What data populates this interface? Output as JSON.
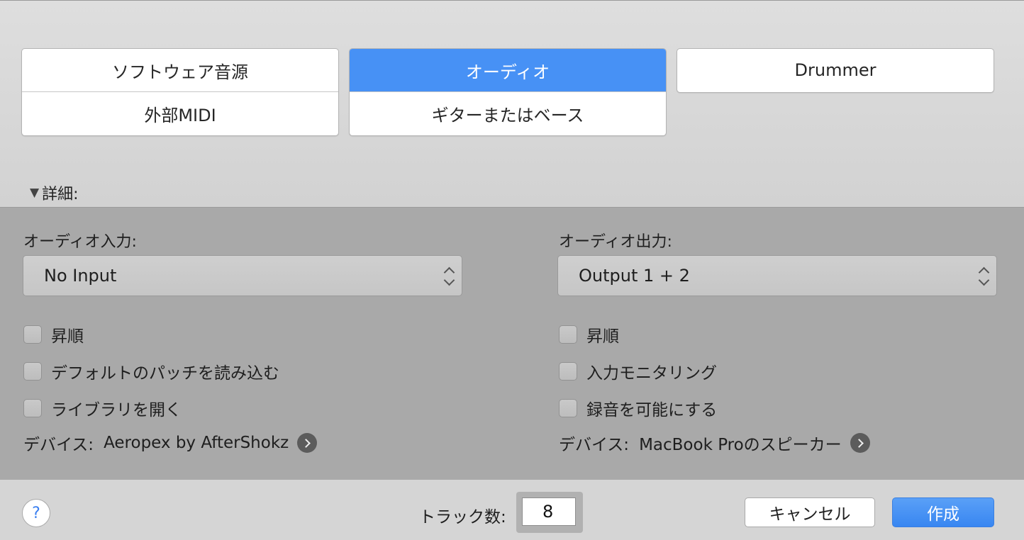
{
  "track_types": {
    "software_instrument": "ソフトウェア音源",
    "external_midi": "外部MIDI",
    "audio": "オーディオ",
    "guitar_or_bass": "ギターまたはベース",
    "drummer": "Drummer",
    "selected": "オーディオ"
  },
  "details": {
    "label": "詳細:",
    "expanded": true
  },
  "input": {
    "label": "オーディオ入力:",
    "value": "No Input",
    "options": [
      {
        "label": "昇順",
        "checked": false
      },
      {
        "label": "デフォルトのパッチを読み込む",
        "checked": false
      },
      {
        "label": "ライブラリを開く",
        "checked": false
      }
    ],
    "device_label": "デバイス:",
    "device_value": "Aeropex by AfterShokz"
  },
  "output": {
    "label": "オーディオ出力:",
    "value": "Output 1 + 2",
    "options": [
      {
        "label": "昇順",
        "checked": false
      },
      {
        "label": "入力モニタリング",
        "checked": false
      },
      {
        "label": "録音を可能にする",
        "checked": false
      }
    ],
    "device_label": "デバイス:",
    "device_value": "MacBook Proのスピーカー"
  },
  "footer": {
    "help": "?",
    "track_count_label": "トラック数:",
    "track_count": "8",
    "cancel": "キャンセル",
    "create": "作成"
  },
  "colors": {
    "accent": "#4791f5",
    "panel": "#a9a9a9",
    "window": "#d4d4d4"
  }
}
